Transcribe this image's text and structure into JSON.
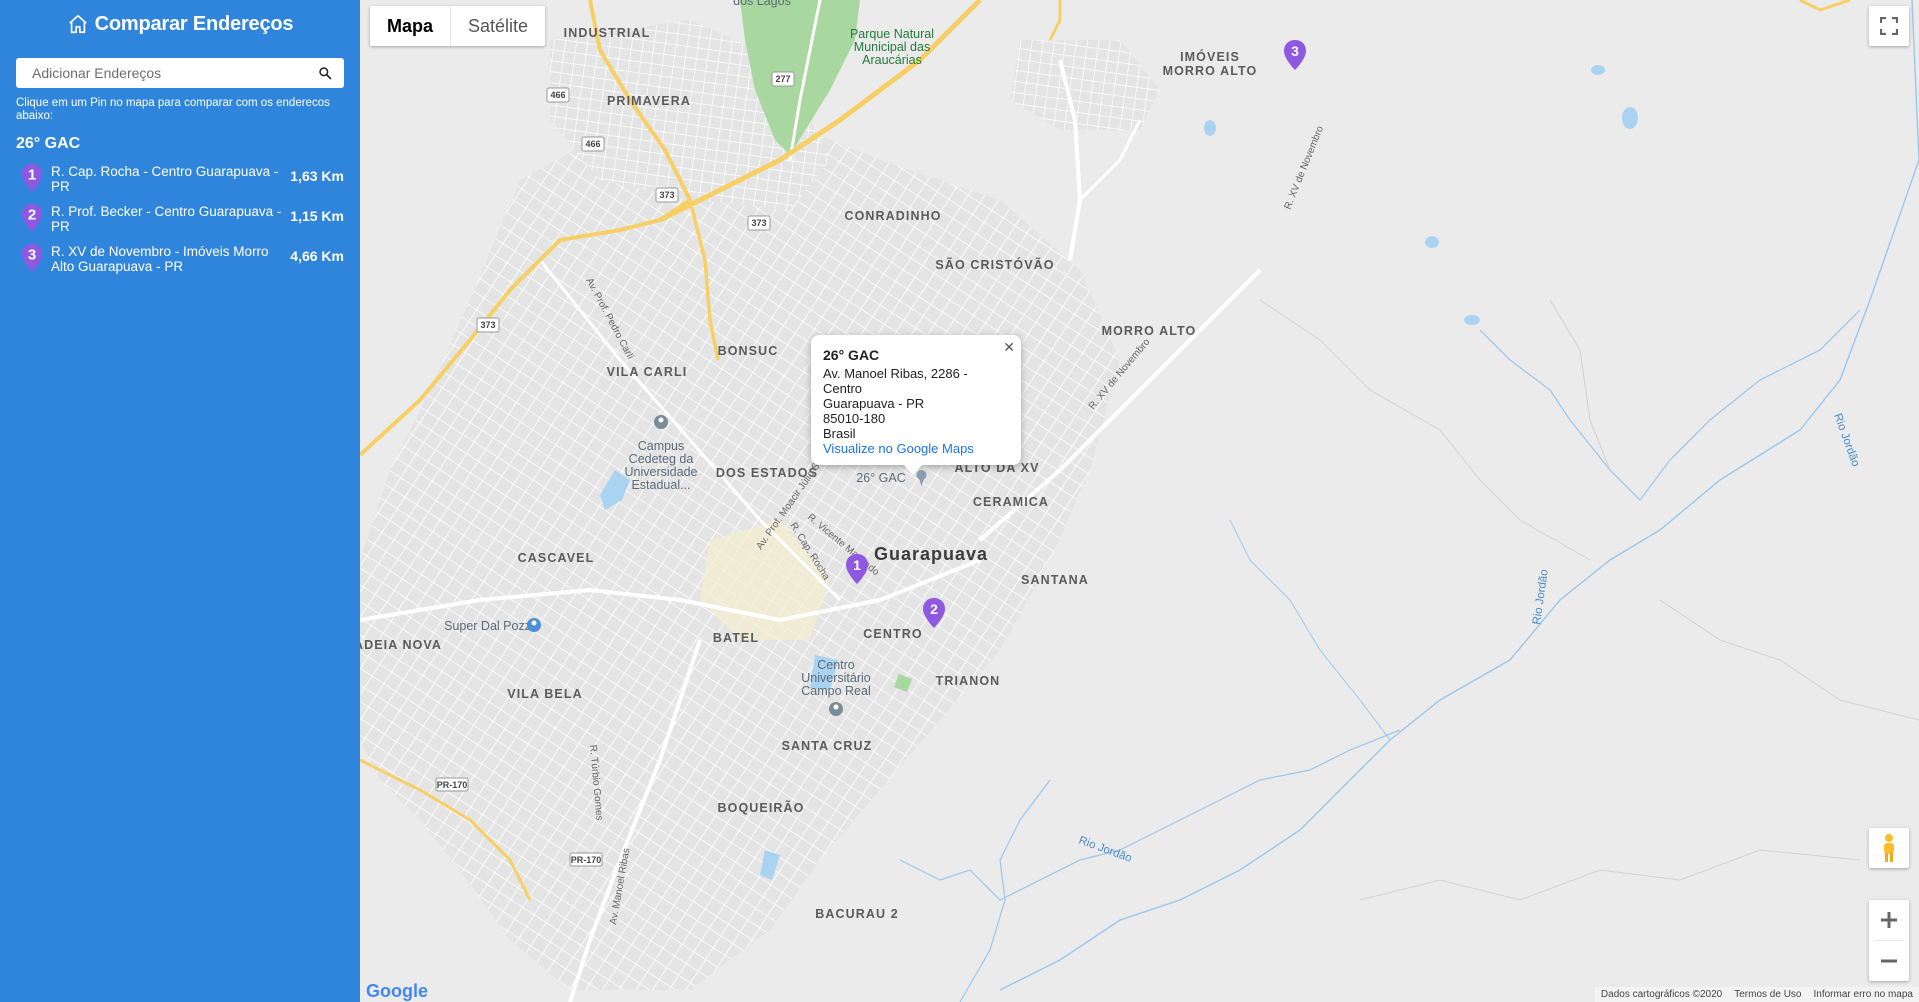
{
  "app": {
    "title": "Comparar Endereços",
    "icon": "home-icon"
  },
  "search": {
    "placeholder": "Adicionar Endereços",
    "value": "",
    "icon": "search-icon"
  },
  "hint": "Clique em um Pin no mapa para comparar com os enderecos abaixo:",
  "origin": {
    "title": "26° GAC"
  },
  "addresses": [
    {
      "number": "1",
      "text": "R. Cap. Rocha - Centro Guarapuava - PR",
      "distance": "1,63 Km"
    },
    {
      "number": "2",
      "text": "R. Prof. Becker - Centro Guarapuava - PR",
      "distance": "1,15 Km"
    },
    {
      "number": "3",
      "text": "R. XV de Novembro - Imóveis Morro Alto Guarapuava - PR",
      "distance": "4,66 Km"
    }
  ],
  "map": {
    "type_buttons": {
      "map": "Mapa",
      "satellite": "Satélite",
      "active": "Mapa"
    },
    "info_window": {
      "title": "26° GAC",
      "line1": "Av. Manoel Ribas, 2286 -",
      "line2": "Centro",
      "line3": "Guarapuava - PR",
      "line4": "85010-180",
      "line5": "Brasil",
      "link": "Visualize no Google Maps"
    },
    "marker_label": "26° GAC",
    "neighborhoods": {
      "industrial": "INDUSTRIAL",
      "primavera": "PRIMAVERA",
      "conradinho": "CONRADINHO",
      "sao_cristovao": "SÃO CRISTÓVÃO",
      "bonsucesso": "BONSUC",
      "vila_carli": "VILA CARLI",
      "dos_estados": "DOS ESTADOS",
      "alto_da_xv": "ALTO DA XV",
      "ceramica": "CERAMICA",
      "morro_alto": "MORRO ALTO",
      "imoveis_1": "IMÓVEIS",
      "imoveis_2": "MORRO ALTO",
      "cascavel": "CASCAVEL",
      "santana": "SANTANA",
      "batel": "BATEL",
      "centro": "CENTRO",
      "trianon": "TRIANON",
      "adeia_nova": "ADEIA NOVA",
      "vila_bela": "VILA BELA",
      "santa_cruz": "SANTA CRUZ",
      "boqueirao": "BOQUEIRÃO",
      "bacurau": "BACURAU 2",
      "city": "Guarapuava"
    },
    "pois": {
      "park_1": "Parque Natural",
      "park_2": "Municipal das",
      "park_3": "Araucárias",
      "campus_1": "Campus",
      "campus_2": "Cedeteg da",
      "campus_3": "Universidade",
      "campus_4": "Estadual...",
      "super": "Super Dal Pozzo",
      "centro_1": "Centro",
      "centro_2": "Universitário",
      "centro_3": "Campo Real",
      "lagos": "dos Lagos"
    },
    "streets": {
      "pedro_carli": "Av. Prof. Pedro Carli",
      "xv_1": "R. XV de Novembro",
      "xv_2": "R. XV de Novembro",
      "moacir": "Av. Prof. Moacir Júlio Silv...",
      "cap_rocha": "R. Cap. Rocha",
      "vicente": "R. Vicente Machado",
      "turbio": "R. Túrbio Gomes",
      "manoel_ribas": "Av. Manoel Ribas"
    },
    "road_shields": [
      "466",
      "466",
      "277",
      "373",
      "373",
      "373",
      "PR-170",
      "PR-170"
    ],
    "rivers": {
      "r1": "Rio Jordão",
      "r2": "Rio Jordão",
      "r3": "Rio Jordão"
    },
    "footer": {
      "data": "Dados cartográficos ©2020",
      "terms": "Termos de Uso",
      "report": "Informar erro no mapa"
    },
    "google_logo": "Google",
    "pin_color": "#8e58e0",
    "sidebar_color": "#2f85db"
  }
}
